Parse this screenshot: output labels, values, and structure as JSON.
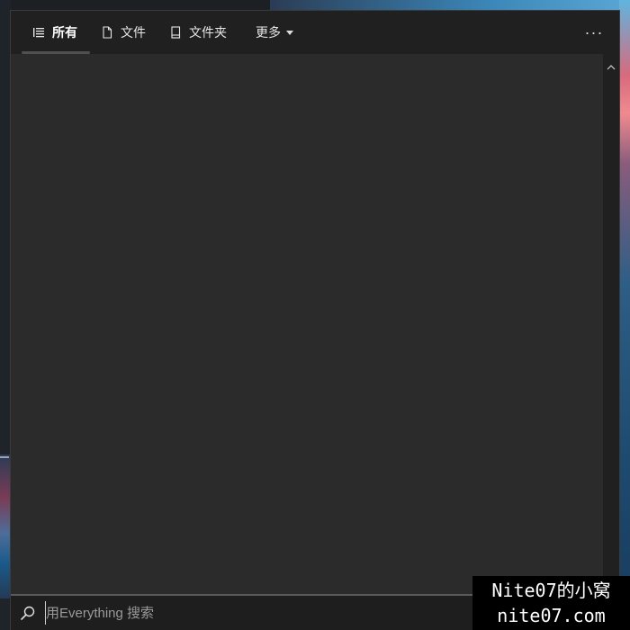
{
  "toolbar": {
    "tabs": [
      {
        "label": "所有",
        "icon": "list-icon",
        "active": true
      },
      {
        "label": "文件",
        "icon": "file-icon",
        "active": false
      },
      {
        "label": "文件夹",
        "icon": "folder-icon",
        "active": false
      },
      {
        "label": "更多",
        "icon": "chevron-down-icon",
        "active": false
      }
    ],
    "menu_icon": "more-icon"
  },
  "results": {
    "items": []
  },
  "search": {
    "placeholder": "用Everything 搜索",
    "value": "",
    "icon": "search-icon"
  },
  "watermark": {
    "line1": "Nite07的小窝",
    "line2": "nite07.com"
  },
  "colors": {
    "window_bg": "#2b2b2b",
    "toolbar_bg": "#202020",
    "text": "#e6e6e6",
    "placeholder": "#9a9a9a"
  }
}
